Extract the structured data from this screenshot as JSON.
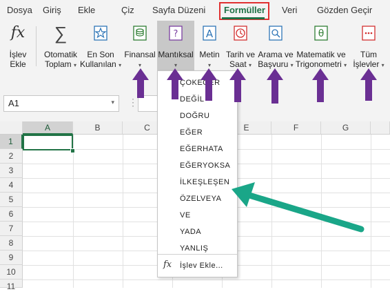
{
  "menu": {
    "tabs": [
      "Dosya",
      "Giriş",
      "Ekle",
      "Çiz",
      "Sayfa Düzeni",
      "Formüller",
      "Veri",
      "Gözden Geçir"
    ],
    "active_index": 5
  },
  "ribbon": {
    "insert_function": {
      "line1": "İşlev",
      "line2": "Ekle"
    },
    "autosum": {
      "line1": "Otomatik",
      "line2": "Toplam"
    },
    "recently_used": {
      "line1": "En Son",
      "line2": "Kullanılan"
    },
    "financial": {
      "line1": "Finansal"
    },
    "logical": {
      "line1": "Mantıksal"
    },
    "text": {
      "line1": "Metin"
    },
    "date_time": {
      "line1": "Tarih ve",
      "line2": "Saat"
    },
    "lookup_reference": {
      "line1": "Arama ve",
      "line2": "Başvuru"
    },
    "math_trig": {
      "line1": "Matematik ve",
      "line2": "Trigonometri"
    },
    "all_functions": {
      "line1": "Tüm",
      "line2": "İşlevler"
    },
    "chevron": "▾"
  },
  "formula_bar": {
    "name_box": "A1",
    "fx_dots": "⋮"
  },
  "grid": {
    "columns": [
      "A",
      "B",
      "C",
      "D",
      "E",
      "F",
      "G"
    ],
    "rows": [
      "1",
      "2",
      "3",
      "4",
      "5",
      "6",
      "7",
      "8",
      "9",
      "10",
      "11"
    ],
    "active_cell": "A1"
  },
  "logical_menu": {
    "items": [
      "ÇOKEĞER",
      "DEĞİL",
      "DOĞRU",
      "EĞER",
      "EĞERHATA",
      "EĞERYOKSA",
      "İLKEŞLEŞEN",
      "ÖZELVEYA",
      "VE",
      "YADA",
      "YANLIŞ"
    ],
    "insert_function_label": "İşlev Ekle..."
  },
  "colors": {
    "accent_green": "#217346",
    "annotation_purple": "#6a2f93",
    "annotation_teal": "#1aa688",
    "highlight_red": "#e03030"
  }
}
